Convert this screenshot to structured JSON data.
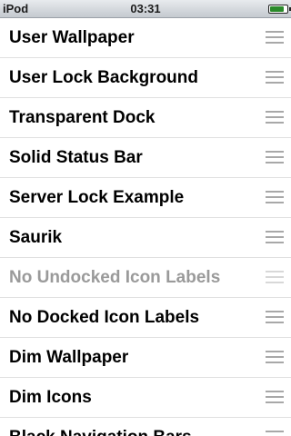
{
  "status_bar": {
    "carrier": "iPod",
    "time": "03:31",
    "battery_level": 0.85,
    "battery_color": "#2a8a2a"
  },
  "list": {
    "items": [
      {
        "label": "User Wallpaper",
        "enabled": true
      },
      {
        "label": "User Lock Background",
        "enabled": true
      },
      {
        "label": "Transparent Dock",
        "enabled": true
      },
      {
        "label": "Solid Status Bar",
        "enabled": true
      },
      {
        "label": "Server Lock Example",
        "enabled": true
      },
      {
        "label": "Saurik",
        "enabled": true
      },
      {
        "label": "No Undocked Icon Labels",
        "enabled": false
      },
      {
        "label": "No Docked Icon Labels",
        "enabled": true
      },
      {
        "label": "Dim Wallpaper",
        "enabled": true
      },
      {
        "label": "Dim Icons",
        "enabled": true
      },
      {
        "label": "Black Navigation Bars",
        "enabled": true
      }
    ]
  }
}
